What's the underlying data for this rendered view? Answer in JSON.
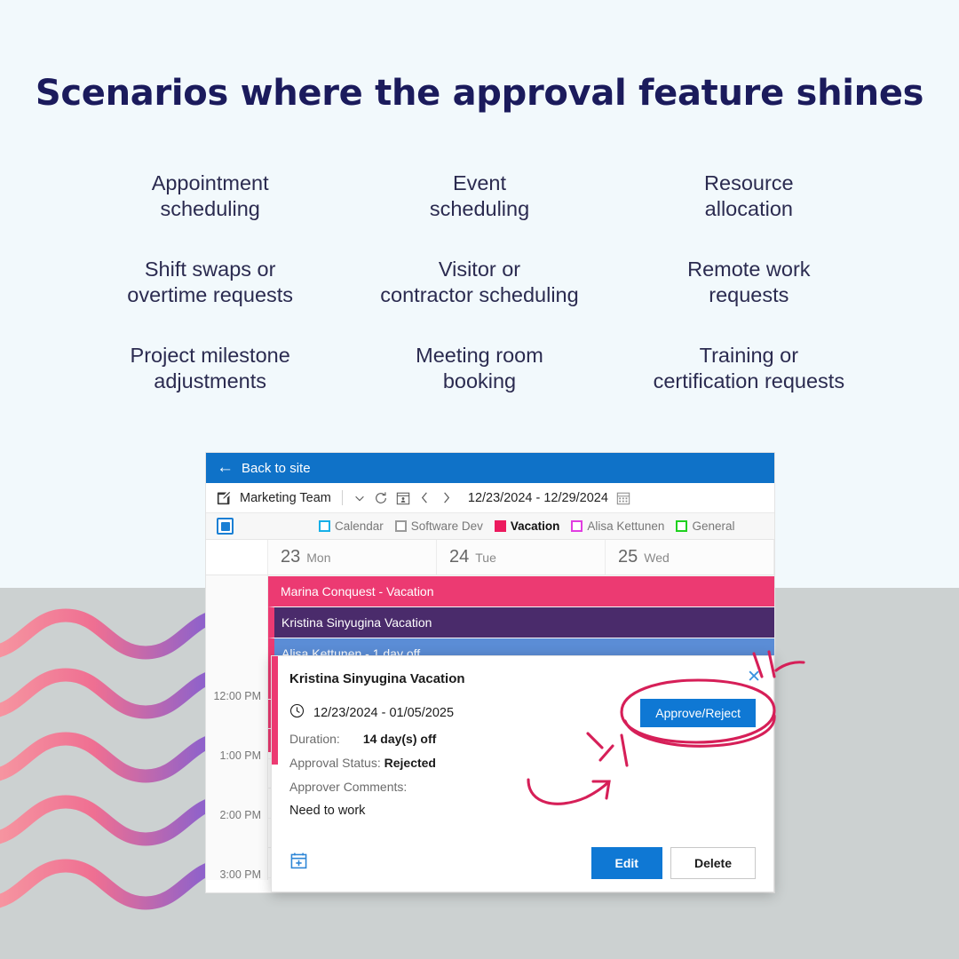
{
  "headline": "Scenarios where the approval feature shines",
  "features": [
    "Appointment\nscheduling",
    "Event\nscheduling",
    "Resource\nallocation",
    "Shift swaps or\novertime requests",
    "Visitor or\ncontractor scheduling",
    "Remote work\nrequests",
    "Project milestone\nadjustments",
    "Meeting room\nbooking",
    "Training or\ncertification requests"
  ],
  "colors": {
    "page_bg": "#f2f9fc",
    "headline": "#1b1b5c",
    "band_bg": "#ccd1d1",
    "topbar_blue": "#0f72c8",
    "accent_blue": "#0f78d4",
    "vacation_pink": "#ec3a72",
    "event_purple": "#4a2b6b",
    "event_blue": "#5b8dd6",
    "annotation_pink": "#d61f58",
    "wave_start": "#f58a96",
    "wave_end": "#7b5fd6"
  },
  "app": {
    "topbar": {
      "back_label": "Back to site",
      "back_icon": "arrow-left-icon"
    },
    "toolbar": {
      "edit_icon": "pencil-square-icon",
      "calendar_name": "Marketing Team",
      "chevron_down_icon": "chevron-down-icon",
      "refresh_icon": "refresh-icon",
      "calendar_person_icon": "calendar-person-icon",
      "prev_icon": "chevron-left-icon",
      "next_icon": "chevron-right-icon",
      "date_range": "12/23/2024 - 12/29/2024",
      "calendar_picker_icon": "calendar-icon"
    },
    "legend": {
      "select_all_state": "indeterminate",
      "items": [
        {
          "label": "Calendar",
          "color": "#17b0e8",
          "filled": false,
          "active": false
        },
        {
          "label": "Software Dev",
          "color": "#9a9a9a",
          "filled": false,
          "active": false
        },
        {
          "label": "Vacation",
          "color": "#ec1a5e",
          "filled": true,
          "active": true
        },
        {
          "label": "Alisa Kettunen",
          "color": "#e13de1",
          "filled": false,
          "active": false
        },
        {
          "label": "General",
          "color": "#1fd11f",
          "filled": false,
          "active": false
        }
      ]
    },
    "days": [
      {
        "num": "23",
        "dow": "Mon"
      },
      {
        "num": "24",
        "dow": "Tue"
      },
      {
        "num": "25",
        "dow": "Wed"
      }
    ],
    "all_day_events": [
      {
        "title": "Marina Conquest - Vacation",
        "style": "pink"
      },
      {
        "title": "Kristina Sinyugina Vacation",
        "style": "purple"
      },
      {
        "title": "Alisa Kettunen - 1 day off",
        "style": "blue"
      }
    ],
    "time_labels": [
      "12:00 PM",
      "1:00 PM",
      "2:00 PM",
      "3:00 PM"
    ]
  },
  "popup": {
    "title": "Kristina Sinyugina Vacation",
    "close_icon": "close-icon",
    "clock_icon": "clock-icon",
    "date_range": "12/23/2024 - 01/05/2025",
    "approve_label": "Approve/Reject",
    "duration_label": "Duration:",
    "duration_value": "14 day(s) off",
    "status_label": "Approval Status:",
    "status_value": "Rejected",
    "comments_label": "Approver Comments:",
    "comments_value": "Need to work",
    "add_calendar_icon": "calendar-plus-icon",
    "edit_label": "Edit",
    "delete_label": "Delete"
  },
  "annotations": {
    "circle_target": "Approve/Reject",
    "arrow_target": "Approve/Reject"
  }
}
